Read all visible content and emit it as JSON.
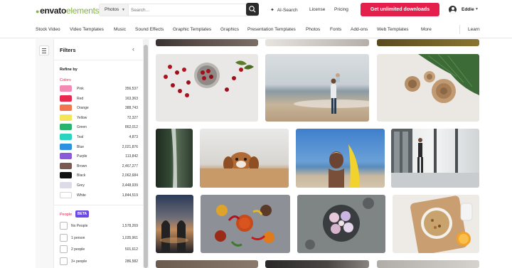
{
  "brand": {
    "name_part1": "envato",
    "name_part2": "elements"
  },
  "search": {
    "category": "Photos",
    "placeholder": "Search..."
  },
  "topnav": {
    "ai_search": "AI-Search",
    "license": "License",
    "pricing": "Pricing",
    "cta": "Get unlimited downloads",
    "user": "Eddie"
  },
  "categories": [
    "Stock Video",
    "Video Templates",
    "Music",
    "Sound Effects",
    "Graphic Templates",
    "Graphics",
    "Presentation Templates",
    "Photos",
    "Fonts",
    "Add-ons",
    "Web Templates",
    "More"
  ],
  "learn": "Learn",
  "sidebar": {
    "title": "Filters",
    "refine_by": "Refine by",
    "colors_label": "Colors",
    "colors": [
      {
        "name": "Pink",
        "count": "356,537",
        "hex": "#f28ab4"
      },
      {
        "name": "Red",
        "count": "163,363",
        "hex": "#e8284f"
      },
      {
        "name": "Orange",
        "count": "388,743",
        "hex": "#f2754e"
      },
      {
        "name": "Yellow",
        "count": "72,327",
        "hex": "#f4e55a"
      },
      {
        "name": "Green",
        "count": "862,012",
        "hex": "#2ab36c"
      },
      {
        "name": "Teal",
        "count": "4,873",
        "hex": "#2ad4c0"
      },
      {
        "name": "Blue",
        "count": "2,021,876",
        "hex": "#2d8fe0"
      },
      {
        "name": "Purple",
        "count": "113,842",
        "hex": "#8a5ad8"
      },
      {
        "name": "Brown",
        "count": "2,467,277",
        "hex": "#7a5a50"
      },
      {
        "name": "Black",
        "count": "2,062,684",
        "hex": "#111111"
      },
      {
        "name": "Grey",
        "count": "3,448,939",
        "hex": "#dedbe8"
      },
      {
        "name": "White",
        "count": "1,844,519",
        "hex": "#ffffff"
      }
    ],
    "people_label": "People",
    "beta": "BETA",
    "people": [
      {
        "name": "No People",
        "count": "1,578,269"
      },
      {
        "name": "1 person",
        "count": "1,035,961"
      },
      {
        "name": "2 people",
        "count": "501,612"
      },
      {
        "name": "3+ people",
        "count": "286,582"
      }
    ]
  },
  "images": [
    "cherries-on-white-table",
    "man-holding-child-on-beach",
    "wooden-bowls-and-palm-leaf",
    "forest-waterfall",
    "dog-peeking-over-table",
    "woman-with-yellow-surfboard",
    "man-stretching-in-gym",
    "mosque-at-sunset",
    "spices-and-chili-peppers",
    "ice-cream-bowls-top-view",
    "granola-breakfast-bowl"
  ]
}
